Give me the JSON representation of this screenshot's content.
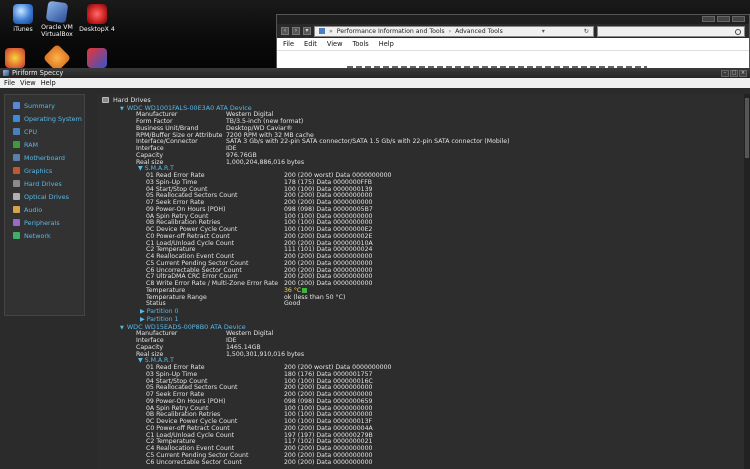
{
  "desktop": {
    "icons": [
      {
        "label": "iTunes",
        "icon": "itunes-icon"
      },
      {
        "label": "Oracle VM VirtualBox",
        "icon": "virtualbox-icon"
      },
      {
        "label": "DesktopX 4",
        "icon": "desktopx-icon"
      }
    ]
  },
  "explorer": {
    "breadcrumb": [
      "Performance Information and Tools",
      "Advanced Tools"
    ],
    "menu": [
      "File",
      "Edit",
      "View",
      "Tools",
      "Help"
    ]
  },
  "speccy": {
    "title": "Piriform Speccy",
    "menu": {
      "file": "File",
      "view": "View",
      "help": "Help"
    },
    "sidebar": [
      {
        "label": "Summary",
        "color": "#5a87d6"
      },
      {
        "label": "Operating System",
        "color": "#3a8be0"
      },
      {
        "label": "CPU",
        "color": "#4a7fc0"
      },
      {
        "label": "RAM",
        "color": "#3d9a3d"
      },
      {
        "label": "Motherboard",
        "color": "#5a7fa8"
      },
      {
        "label": "Graphics",
        "color": "#c05a2a"
      },
      {
        "label": "Hard Drives",
        "color": "#8a8a8a"
      },
      {
        "label": "Optical Drives",
        "color": "#b0b0b0"
      },
      {
        "label": "Audio",
        "color": "#d6a24a"
      },
      {
        "label": "Peripherals",
        "color": "#9a6ac8"
      },
      {
        "label": "Network",
        "color": "#3fae6a"
      }
    ],
    "section_title": "Hard Drives",
    "drive1": {
      "name": "WDC WD1001FALS-00E3A0 ATA Device",
      "props": [
        [
          "Manufacturer",
          "Western Digital"
        ],
        [
          "Form Factor",
          "TB/3.5-inch (new format)"
        ],
        [
          "Business Unit/Brand",
          "Desktop/WD Caviar®"
        ],
        [
          "RPM/Buffer Size or Attribute",
          "7200 RPM with 32 MB cache"
        ],
        [
          "Interface/Connector",
          "SATA 3 Gb/s with 22-pin SATA connector/SATA 1.5 Gb/s with 22-pin SATA connector (Mobile)"
        ],
        [
          "Interface",
          "IDE"
        ],
        [
          "Capacity",
          "976.76GB"
        ],
        [
          "Real size",
          "1,000,204,886,016 bytes"
        ]
      ],
      "smart_label": "S.M.A.R.T",
      "smart": [
        [
          "01 Read Error Rate",
          "200 (200 worst) Data 0000000000"
        ],
        [
          "03 Spin-Up Time",
          "178 (175) Data 0000000FFB"
        ],
        [
          "04 Start/Stop Count",
          "100 (100) Data 0000000139"
        ],
        [
          "05 Reallocated Sectors Count",
          "200 (200) Data 0000000000"
        ],
        [
          "07 Seek Error Rate",
          "200 (200) Data 0000000000"
        ],
        [
          "09 Power-On Hours (POH)",
          "098 (098) Data 00000005B7"
        ],
        [
          "0A Spin Retry Count",
          "100 (100) Data 0000000000"
        ],
        [
          "0B Recalibration Retries",
          "100 (100) Data 0000000000"
        ],
        [
          "0C Device Power Cycle Count",
          "100 (100) Data 00000000E2"
        ],
        [
          "C0 Power-off Retract Count",
          "200 (200) Data 000000002E"
        ],
        [
          "C1 Load/Unload Cycle Count",
          "200 (200) Data 000000010A"
        ],
        [
          "C2 Temperature",
          "111 (101) Data 0000000024"
        ],
        [
          "C4 Reallocation Event Count",
          "200 (200) Data 0000000000"
        ],
        [
          "C5 Current Pending Sector Count",
          "200 (200) Data 0000000000"
        ],
        [
          "C6 Uncorrectable Sector Count",
          "200 (200) Data 0000000000"
        ],
        [
          "C7 UltraDMA CRC Error Count",
          "200 (200) Data 0000000000"
        ],
        [
          "C8 Write Error Rate / Multi-Zone Error Rate",
          "200 (200) Data 0000000000"
        ]
      ],
      "temperature": {
        "label": "Temperature",
        "value": "36 °C"
      },
      "temp_range": {
        "label": "Temperature Range",
        "value": "ok (less than 50 °C)"
      },
      "status": {
        "label": "Status",
        "value": "Good"
      },
      "partitions": [
        "Partition 0",
        "Partition 1"
      ]
    },
    "drive2": {
      "name": "WDC WD15EADS-00P8B0 ATA Device",
      "props": [
        [
          "Manufacturer",
          "Western Digital"
        ],
        [
          "Interface",
          "IDE"
        ],
        [
          "Capacity",
          "1465.14GB"
        ],
        [
          "Real size",
          "1,500,301,910,016 bytes"
        ]
      ],
      "smart_label": "S.M.A.R.T",
      "smart": [
        [
          "01 Read Error Rate",
          "200 (200 worst) Data 0000000000"
        ],
        [
          "03 Spin-Up Time",
          "180 (176) Data 0000001757"
        ],
        [
          "04 Start/Stop Count",
          "100 (100) Data 000000016C"
        ],
        [
          "05 Reallocated Sectors Count",
          "200 (200) Data 0000000000"
        ],
        [
          "07 Seek Error Rate",
          "200 (200) Data 0000000000"
        ],
        [
          "09 Power-On Hours (POH)",
          "098 (098) Data 0000000659"
        ],
        [
          "0A Spin Retry Count",
          "100 (100) Data 0000000000"
        ],
        [
          "0B Recalibration Retries",
          "100 (100) Data 0000000000"
        ],
        [
          "0C Device Power Cycle Count",
          "100 (100) Data 000000013F"
        ],
        [
          "C0 Power-off Retract Count",
          "200 (200) Data 000000004A"
        ],
        [
          "C1 Load/Unload Cycle Count",
          "197 (197) Data 000000279B"
        ],
        [
          "C2 Temperature",
          "117 (102) Data 0000000021"
        ],
        [
          "C4 Reallocation Event Count",
          "200 (200) Data 0000000000"
        ],
        [
          "C5 Current Pending Sector Count",
          "200 (200) Data 0000000000"
        ],
        [
          "C6 Uncorrectable Sector Count",
          "200 (200) Data 0000000000"
        ]
      ]
    }
  }
}
